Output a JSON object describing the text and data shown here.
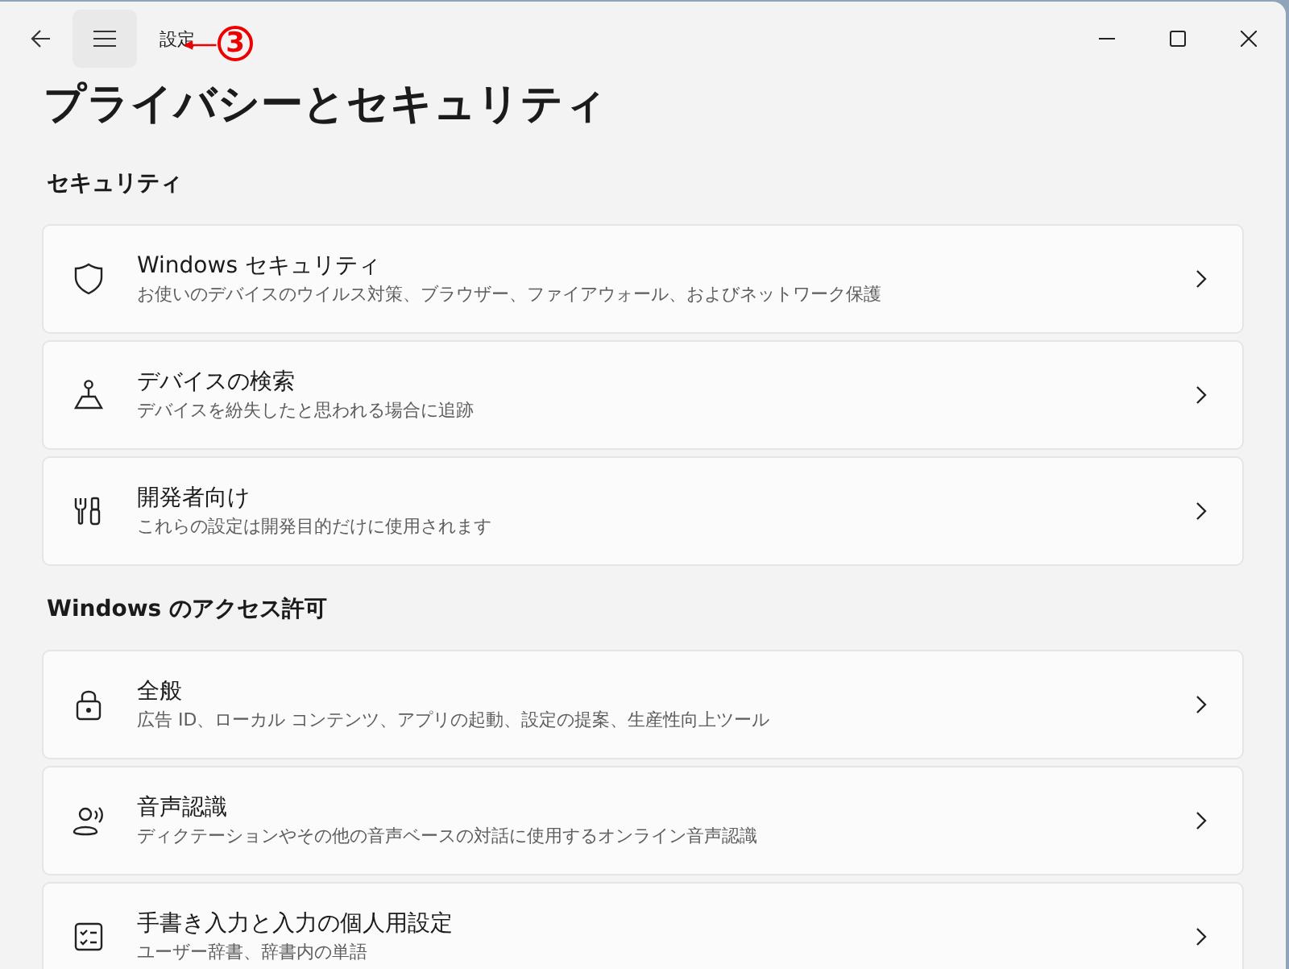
{
  "window": {
    "app_name": "設定",
    "title": "プライバシーとセキュリティ"
  },
  "annotation": {
    "label": "3"
  },
  "sections": [
    {
      "heading": "セキュリティ",
      "items": [
        {
          "kind": "shield",
          "title": "Windows セキュリティ",
          "subtitle": "お使いのデバイスのウイルス対策、ブラウザー、ファイアウォール、およびネットワーク保護"
        },
        {
          "kind": "locate",
          "title": "デバイスの検索",
          "subtitle": "デバイスを紛失したと思われる場合に追跡"
        },
        {
          "kind": "tools",
          "title": "開発者向け",
          "subtitle": "これらの設定は開発目的だけに使用されます"
        }
      ]
    },
    {
      "heading": "Windows のアクセス許可",
      "items": [
        {
          "kind": "lock",
          "title": "全般",
          "subtitle": "広告 ID、ローカル コンテンツ、アプリの起動、設定の提案、生産性向上ツール"
        },
        {
          "kind": "speech",
          "title": "音声認識",
          "subtitle": "ディクテーションやその他の音声ベースの対話に使用するオンライン音声認識"
        },
        {
          "kind": "checklist",
          "title": "手書き入力と入力の個人用設定",
          "subtitle": "ユーザー辞書、辞書内の単語"
        }
      ]
    }
  ]
}
